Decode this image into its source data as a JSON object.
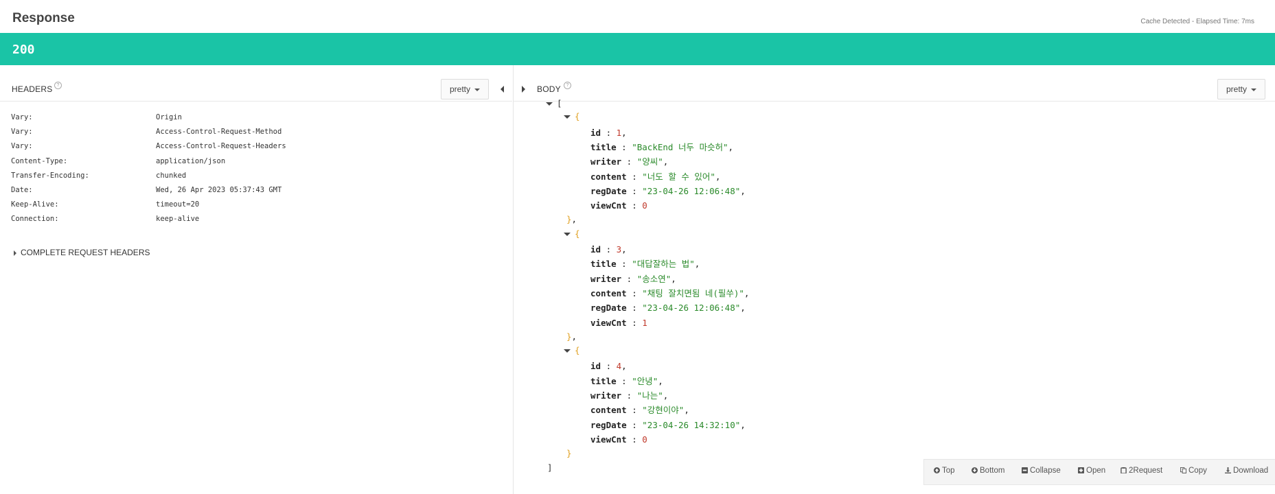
{
  "header": {
    "title": "Response",
    "cache_info": "Cache Detected - Elapsed Time: 7ms"
  },
  "status": {
    "code": "200",
    "color": "#1ac4a6"
  },
  "headers_panel": {
    "label": "HEADERS",
    "format": "pretty",
    "rows": [
      {
        "name": "Vary:",
        "value": "Origin"
      },
      {
        "name": "Vary:",
        "value": "Access-Control-Request-Method"
      },
      {
        "name": "Vary:",
        "value": "Access-Control-Request-Headers"
      },
      {
        "name": "Content-Type:",
        "value": "application/json"
      },
      {
        "name": "Transfer-Encoding:",
        "value": "chunked"
      },
      {
        "name": "Date:",
        "value": "Wed, 26 Apr 2023 05:37:43 GMT"
      },
      {
        "name": "Keep-Alive:",
        "value": "timeout=20"
      },
      {
        "name": "Connection:",
        "value": "keep-alive"
      }
    ],
    "complete_request_label": "COMPLETE REQUEST HEADERS"
  },
  "body_panel": {
    "label": "BODY",
    "format": "pretty",
    "items": [
      {
        "id": "1",
        "title": "\"BackEnd 너두 마슷허\"",
        "writer": "\"양씨\"",
        "content": "\"너도 할 수 있어\"",
        "regDate": "\"23-04-26 12:06:48\"",
        "viewCnt": "0"
      },
      {
        "id": "3",
        "title": "\"대답잘하는 법\"",
        "writer": "\"송소연\"",
        "content": "\"채팅 잘치면됨 네(필쑤)\"",
        "regDate": "\"23-04-26 12:06:48\"",
        "viewCnt": "1"
      },
      {
        "id": "4",
        "title": "\"안녕\"",
        "writer": "\"나는\"",
        "content": "\"강현이야\"",
        "regDate": "\"23-04-26 14:32:10\"",
        "viewCnt": "0"
      }
    ]
  },
  "toolbar": {
    "top": "Top",
    "bottom": "Bottom",
    "collapse": "Collapse",
    "open": "Open",
    "request": "2Request",
    "copy": "Copy",
    "download": "Download"
  }
}
